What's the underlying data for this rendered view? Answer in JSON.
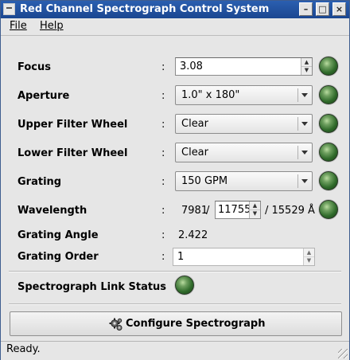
{
  "window": {
    "title": "Red Channel Spectrograph Control System",
    "buttons": {
      "minimize": "–",
      "maximize": "□",
      "close": "×"
    }
  },
  "menu": {
    "file": "File",
    "help": "Help"
  },
  "colon": ":",
  "focus": {
    "label": "Focus",
    "value": "3.08"
  },
  "aperture": {
    "label": "Aperture",
    "selected": "1.0\" x 180\""
  },
  "upper_filter": {
    "label": "Upper Filter Wheel",
    "selected": "Clear"
  },
  "lower_filter": {
    "label": "Lower Filter Wheel",
    "selected": "Clear"
  },
  "grating": {
    "label": "Grating",
    "selected": "150 GPM"
  },
  "wavelength": {
    "label": "Wavelength",
    "min": "7981",
    "sep1": "/",
    "value": "11755",
    "max": "/ 15529 Å"
  },
  "grating_angle": {
    "label": "Grating Angle",
    "value": "2.422"
  },
  "grating_order": {
    "label": "Grating Order",
    "value": "1"
  },
  "link_status": {
    "label": "Spectrograph Link Status"
  },
  "configure_button": {
    "label": "Configure Spectrograph"
  },
  "status": {
    "text": "Ready."
  },
  "icons": {
    "led": "green-status-led",
    "configure": "gears-icon",
    "spinner": "spin-arrows-icon",
    "combo": "dropdown-arrow-icon"
  },
  "colors": {
    "titlebar": "#1f4f9e",
    "led_green": "#3f7a35",
    "window_bg": "#e6e6e6"
  }
}
